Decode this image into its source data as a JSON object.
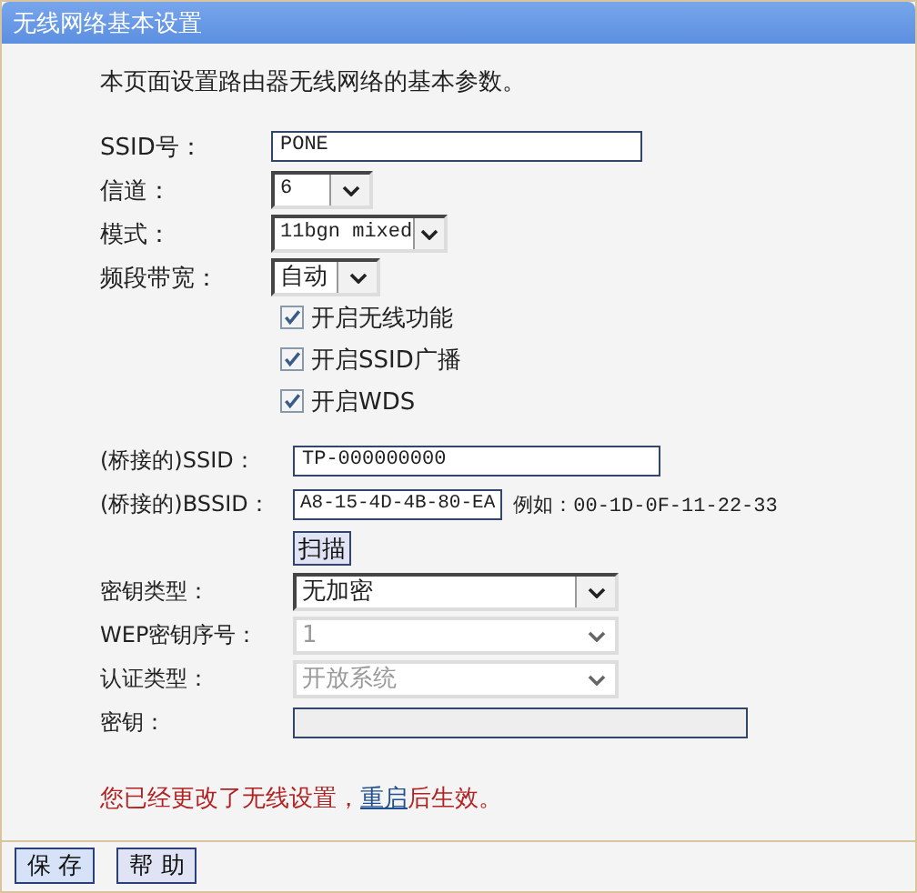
{
  "window": {
    "title": "无线网络基本设置"
  },
  "intro": "本页面设置路由器无线网络的基本参数。",
  "basic_fields": [
    {
      "label": "SSID号：",
      "kind": "text",
      "value": "PONE"
    },
    {
      "label": "信道：",
      "kind": "select",
      "value": "6"
    },
    {
      "label": "模式：",
      "kind": "select",
      "value": "11bgn mixed"
    },
    {
      "label": "频段带宽：",
      "kind": "select",
      "value": "自动"
    }
  ],
  "checkboxes": [
    {
      "label": "开启无线功能",
      "checked": true
    },
    {
      "label": "开启SSID广播",
      "checked": true
    },
    {
      "label": "开启WDS",
      "checked": true
    }
  ],
  "bridge_fields": [
    {
      "label": "(桥接的)SSID：",
      "kind": "text",
      "value": "TP-000000000"
    },
    {
      "label": "(桥接的)BSSID：",
      "kind": "text",
      "value": "A8-15-4D-4B-80-EA",
      "hint": "例如：00-1D-0F-11-22-33"
    }
  ],
  "scan_button": "扫描",
  "security_fields": [
    {
      "label": "密钥类型：",
      "kind": "select",
      "value": "无加密",
      "disabled": false
    },
    {
      "label": "WEP密钥序号：",
      "kind": "select",
      "value": "1",
      "disabled": true
    },
    {
      "label": "认证类型：",
      "kind": "select",
      "value": "开放系统",
      "disabled": true
    },
    {
      "label": "密钥：",
      "kind": "text",
      "disabled": true
    }
  ],
  "notice": {
    "before": "您已经更改了无线设置，",
    "link": "重启",
    "after": "后生效。"
  },
  "buttons": [
    "保 存",
    "帮 助"
  ]
}
